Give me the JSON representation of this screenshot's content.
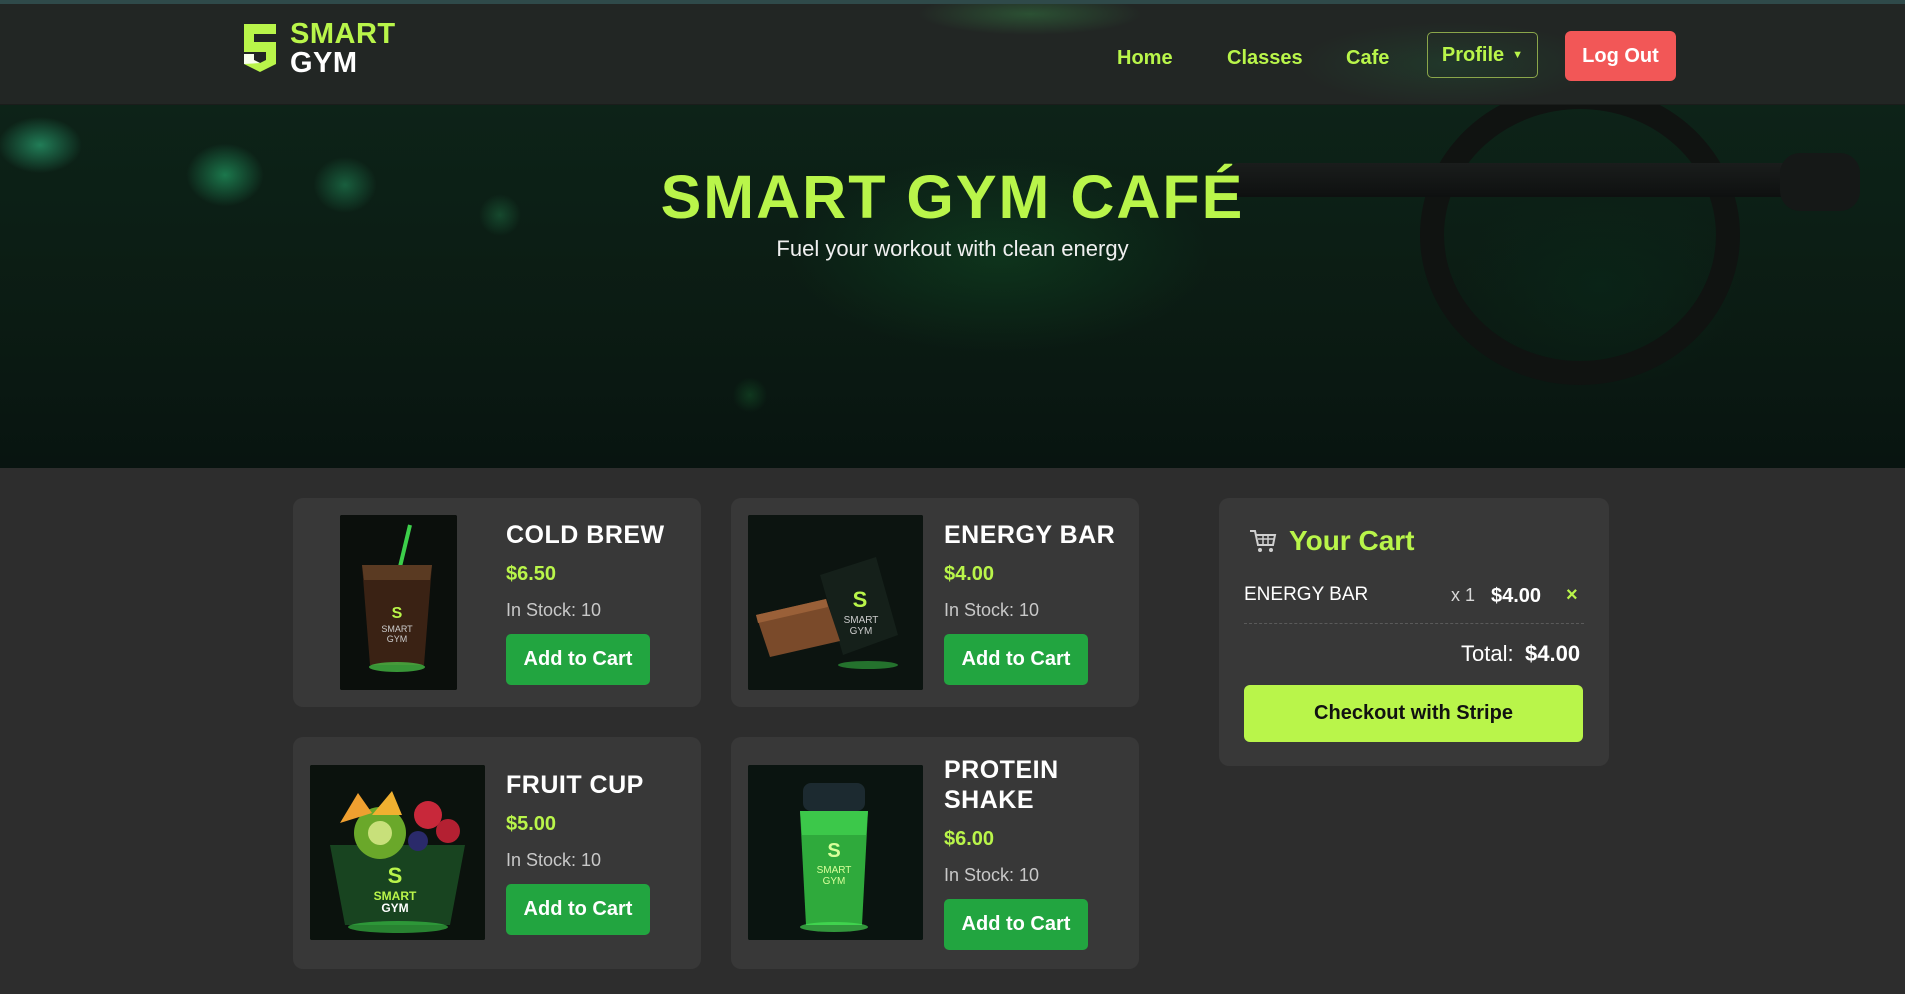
{
  "navbar": {
    "logo_line1": "SMART",
    "logo_line2": "GYM",
    "links": [
      "Home",
      "Classes",
      "Cafe"
    ],
    "profile_label": "Profile",
    "logout_label": "Log Out"
  },
  "hero": {
    "title": "SMART GYM CAFÉ",
    "subtitle": "Fuel your workout with clean energy"
  },
  "products": [
    {
      "name": "COLD BREW",
      "price": "$6.50",
      "stock": "In Stock: 10",
      "button": "Add to Cart",
      "image_logo_1": "SMART",
      "image_logo_2": "GYM"
    },
    {
      "name": "ENERGY BAR",
      "price": "$4.00",
      "stock": "In Stock: 10",
      "button": "Add to Cart",
      "image_logo_1": "SMART",
      "image_logo_2": "GYM"
    },
    {
      "name": "FRUIT CUP",
      "price": "$5.00",
      "stock": "In Stock: 10",
      "button": "Add to Cart",
      "image_logo_1": "SMART",
      "image_logo_2": "GYM"
    },
    {
      "name_line1": "PROTEIN",
      "name_line2": "SHAKE",
      "price": "$6.00",
      "stock": "In Stock: 10",
      "button": "Add to Cart",
      "image_logo_1": "SMART",
      "image_logo_2": "GYM"
    }
  ],
  "cart": {
    "title": "Your Cart",
    "items": [
      {
        "name": "ENERGY BAR",
        "qty": "x 1",
        "price": "$4.00",
        "remove": "×"
      }
    ],
    "total_label": "Total:",
    "total_value": "$4.00",
    "checkout_label": "Checkout with Stripe"
  },
  "colors": {
    "accent": "#b9f54a",
    "button_green": "#22a540",
    "logout_red": "#f25757",
    "page_bg": "#2d2d2d",
    "card_bg": "#383838"
  },
  "icons": [
    "logo-s-shield",
    "caret-down-icon",
    "cart-icon",
    "close-icon"
  ]
}
